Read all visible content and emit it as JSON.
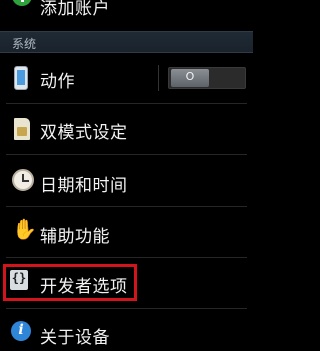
{
  "settings": {
    "add_account": {
      "label": "添加账户",
      "icon": "plus-icon",
      "icon_color": "#2fa33b"
    },
    "system_section": {
      "header": "系统"
    },
    "items": [
      {
        "key": "motion",
        "label": "动作",
        "icon": "phone-icon",
        "toggle": {
          "state": "off",
          "text": "O"
        }
      },
      {
        "key": "dual_mode",
        "label": "双模式设定",
        "icon": "sim-card-icon"
      },
      {
        "key": "date_time",
        "label": "日期和时间",
        "icon": "clock-icon"
      },
      {
        "key": "accessibility",
        "label": "辅助功能",
        "icon": "hand-icon"
      },
      {
        "key": "developer_options",
        "label": "开发者选项",
        "icon": "braces-icon",
        "icon_text": "{}",
        "highlighted": true,
        "highlight_color": "#d2141c"
      },
      {
        "key": "about_device",
        "label": "关于设备",
        "icon": "info-icon",
        "icon_text": "i",
        "icon_color": "#2f86d9"
      }
    ]
  }
}
